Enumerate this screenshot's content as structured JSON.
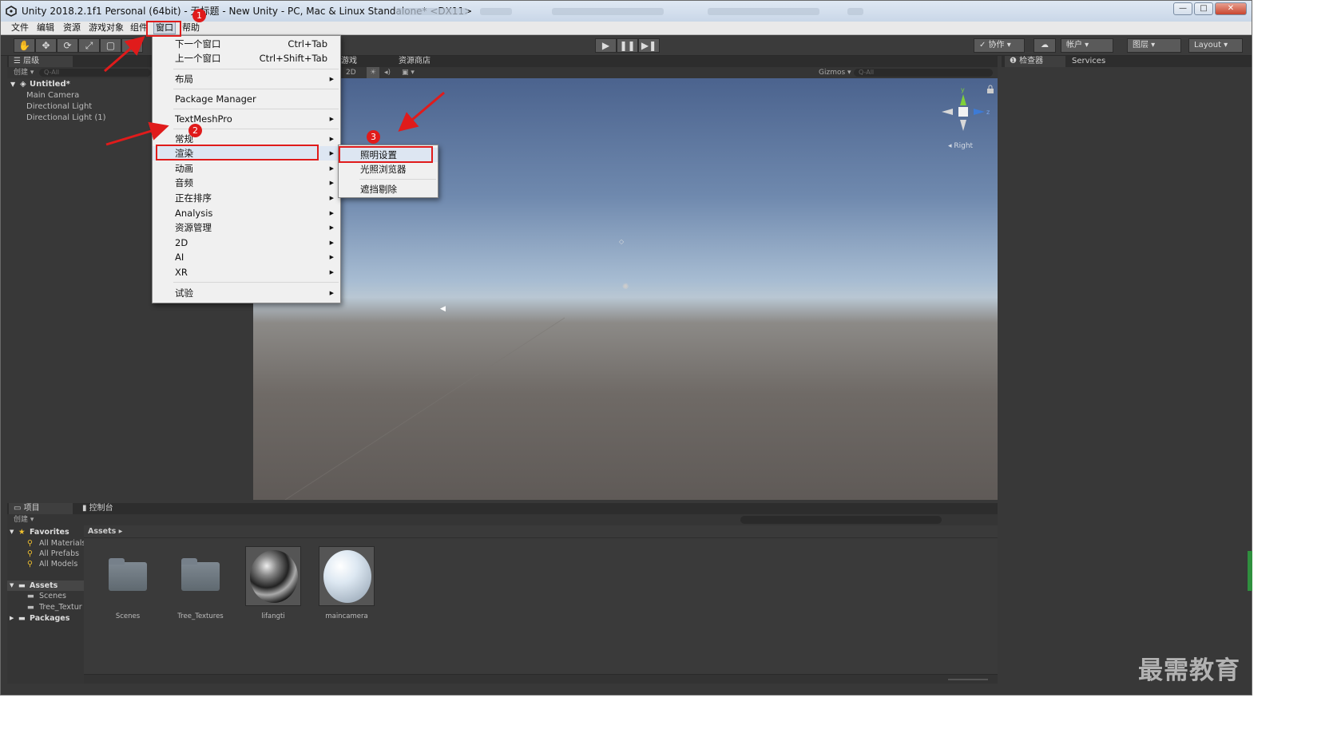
{
  "window": {
    "title": "Unity 2018.2.1f1 Personal (64bit) - 无标题 - New Unity - PC, Mac & Linux Standalone* <DX11>",
    "controls": [
      "—",
      "□",
      "✕"
    ]
  },
  "menubar": [
    "文件",
    "编辑",
    "资源",
    "游戏对象",
    "组件",
    "窗口",
    "帮助"
  ],
  "toolbar": {
    "tools": [
      "✋",
      "✥",
      "⟳",
      "⤢",
      "▢",
      "⊕"
    ],
    "play": [
      "▶",
      "❚❚",
      "▶❚"
    ],
    "right": [
      "✓ 协作 ▾",
      "☁",
      "帐户 ▾",
      "图层 ▾",
      "Layout ▾"
    ]
  },
  "hierarchy": {
    "tab": "☰ 层级",
    "create": "创建 ▾",
    "search": "Q-All",
    "scene": "Untitled*",
    "items": [
      "Main Camera",
      "Directional Light",
      "Directional Light (1)"
    ]
  },
  "scene": {
    "tabs": [
      "游戏",
      "资源商店"
    ],
    "toolbar": [
      "2D",
      "☀",
      "◂)",
      "▣ ▾"
    ],
    "gizmos": "Gizmos ▾",
    "search": "Q-All",
    "orientation": {
      "y": "y",
      "z": "z",
      "view": "◂ Right"
    }
  },
  "inspector": {
    "tabs": [
      "检查器",
      "Services"
    ]
  },
  "project": {
    "tabs": [
      "项目",
      "控制台"
    ],
    "create": "创建 ▾",
    "favorites": {
      "title": "Favorites",
      "items": [
        "All Materials",
        "All Prefabs",
        "All Models"
      ]
    },
    "assets": {
      "title": "Assets",
      "items": [
        "Scenes",
        "Tree_Textur"
      ]
    },
    "packages": "Packages",
    "breadcrumb": "Assets ▸",
    "grid": [
      "Scenes",
      "Tree_Textures",
      "lifangti",
      "maincamera"
    ]
  },
  "window_menu": {
    "items": [
      {
        "label": "下一个窗口",
        "shortcut": "Ctrl+Tab"
      },
      {
        "label": "上一个窗口",
        "shortcut": "Ctrl+Shift+Tab"
      },
      {
        "label": "布局",
        "arrow": "▶"
      },
      {
        "label": "Package Manager"
      },
      {
        "label": "TextMeshPro",
        "arrow": "▶"
      },
      {
        "label": "常规",
        "arrow": "▶"
      },
      {
        "label": "渲染",
        "arrow": "▶"
      },
      {
        "label": "动画",
        "arrow": "▶"
      },
      {
        "label": "音频",
        "arrow": "▶"
      },
      {
        "label": "正在排序",
        "arrow": "▶"
      },
      {
        "label": "Analysis",
        "arrow": "▶"
      },
      {
        "label": "资源管理",
        "arrow": "▶"
      },
      {
        "label": "2D",
        "arrow": "▶"
      },
      {
        "label": "AI",
        "arrow": "▶"
      },
      {
        "label": "XR",
        "arrow": "▶"
      },
      {
        "label": "试验",
        "arrow": "▶"
      }
    ]
  },
  "render_submenu": {
    "items": [
      "照明设置",
      "光照浏览器",
      "遮挡剔除"
    ]
  },
  "annotations": {
    "badges": [
      "1",
      "2",
      "3"
    ],
    "color": "#e01b1b"
  },
  "watermark": "最需教育"
}
